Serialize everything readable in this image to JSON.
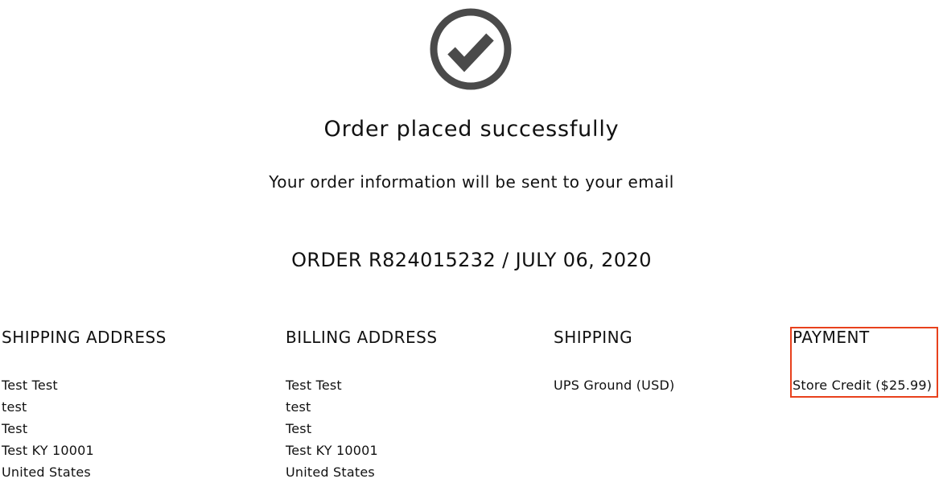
{
  "icons": {
    "success": "check-circle-icon",
    "color": "#4a4a4a"
  },
  "confirmation": {
    "title": "Order placed successfully",
    "subtitle": "Your order information will be sent to your email",
    "order_line": "ORDER R824015232 / JULY 06, 2020"
  },
  "shipping_address": {
    "heading": "SHIPPING ADDRESS",
    "lines": [
      "Test Test",
      "test",
      "Test",
      "Test KY 10001",
      "United States"
    ]
  },
  "billing_address": {
    "heading": "BILLING ADDRESS",
    "lines": [
      "Test Test",
      "test",
      "Test",
      "Test KY 10001",
      "United States"
    ]
  },
  "shipping": {
    "heading": "SHIPPING",
    "method": "UPS Ground (USD)"
  },
  "payment": {
    "heading": "PAYMENT",
    "method": "Store Credit ($25.99)",
    "highlight_color": "#e8411c"
  }
}
